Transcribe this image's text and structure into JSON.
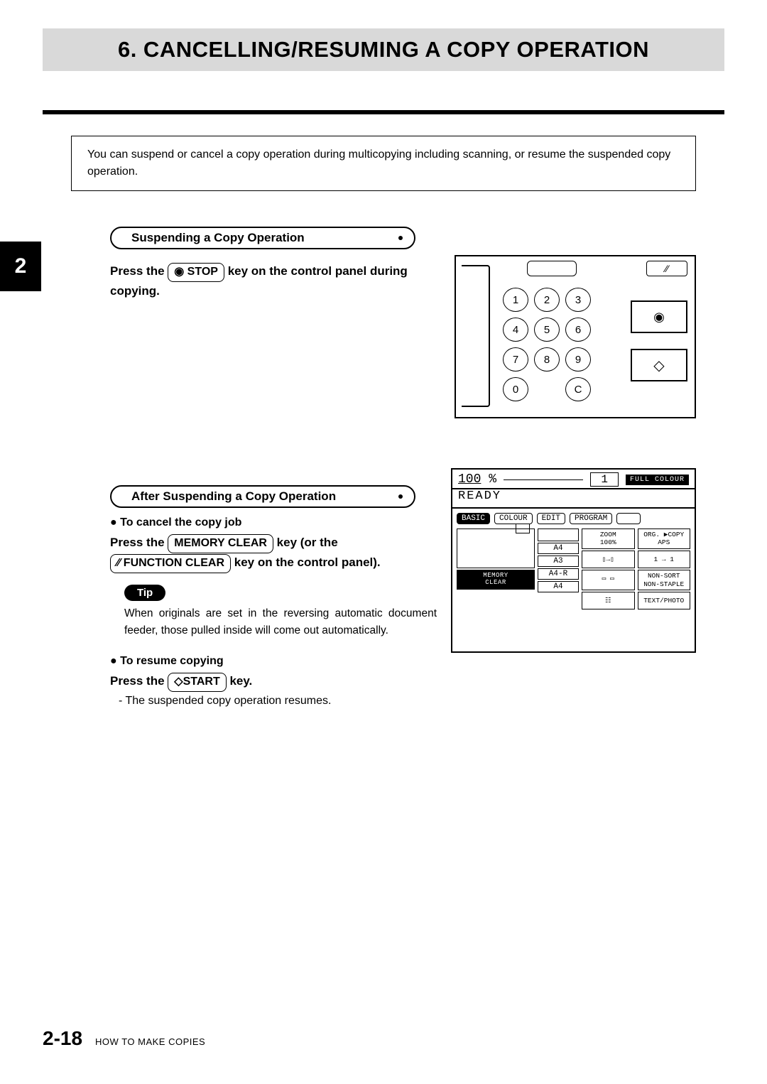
{
  "title": "6. CANCELLING/RESUMING A COPY OPERATION",
  "chapter_tab": "2",
  "intro": "You can suspend or cancel a copy operation during multicopying including scanning, or resume the suspended copy operation.",
  "section1": {
    "heading": "Suspending a Copy Operation",
    "line_prefix": "Press the ",
    "key_label": "◉ STOP",
    "line_suffix": " key on the control panel during copying."
  },
  "section2": {
    "heading": "After Suspending a Copy Operation",
    "cancel_bullet": "To cancel the copy job",
    "cancel": {
      "prefix": "Press the ",
      "key1": "MEMORY CLEAR",
      "mid": " key (or the ",
      "key2": "⁄⁄ FUNCTION CLEAR",
      "suffix": " key on the control panel)."
    },
    "tip_label": "Tip",
    "tip_text": "When originals are set in the reversing automatic document feeder, those pulled inside will come out automatically.",
    "resume_bullet": "To resume copying",
    "resume": {
      "prefix": "Press the ",
      "key": "◇START",
      "suffix": " key."
    },
    "resume_note": "- The suspended copy operation resumes."
  },
  "keypad": {
    "keys": [
      "1",
      "2",
      "3",
      "4",
      "5",
      "6",
      "7",
      "8",
      "9",
      "0",
      "C"
    ],
    "stop_glyph": "◉",
    "start_glyph": "◇",
    "clear_glyph": "⁄⁄"
  },
  "lcd": {
    "zoom_value": "100",
    "zoom_unit": "%",
    "copies": "1",
    "full_colour": "FULL COLOUR",
    "status": "READY",
    "tabs": [
      "BASIC",
      "COLOUR",
      "EDIT",
      "PROGRAM"
    ],
    "zoom_label": "ZOOM",
    "zoom_100": "100%",
    "org_copy": "ORG. ▶COPY",
    "aps": "APS",
    "duplex": "1 → 1",
    "sort": "NON-SORT\nNON-STAPLE",
    "textphoto": "TEXT/PHOTO",
    "trays": [
      "A4",
      "A3",
      "A4-R",
      "A4"
    ],
    "mem_clear": "MEMORY\nCLEAR"
  },
  "footer": {
    "page": "2-18",
    "label": "HOW TO MAKE COPIES"
  }
}
